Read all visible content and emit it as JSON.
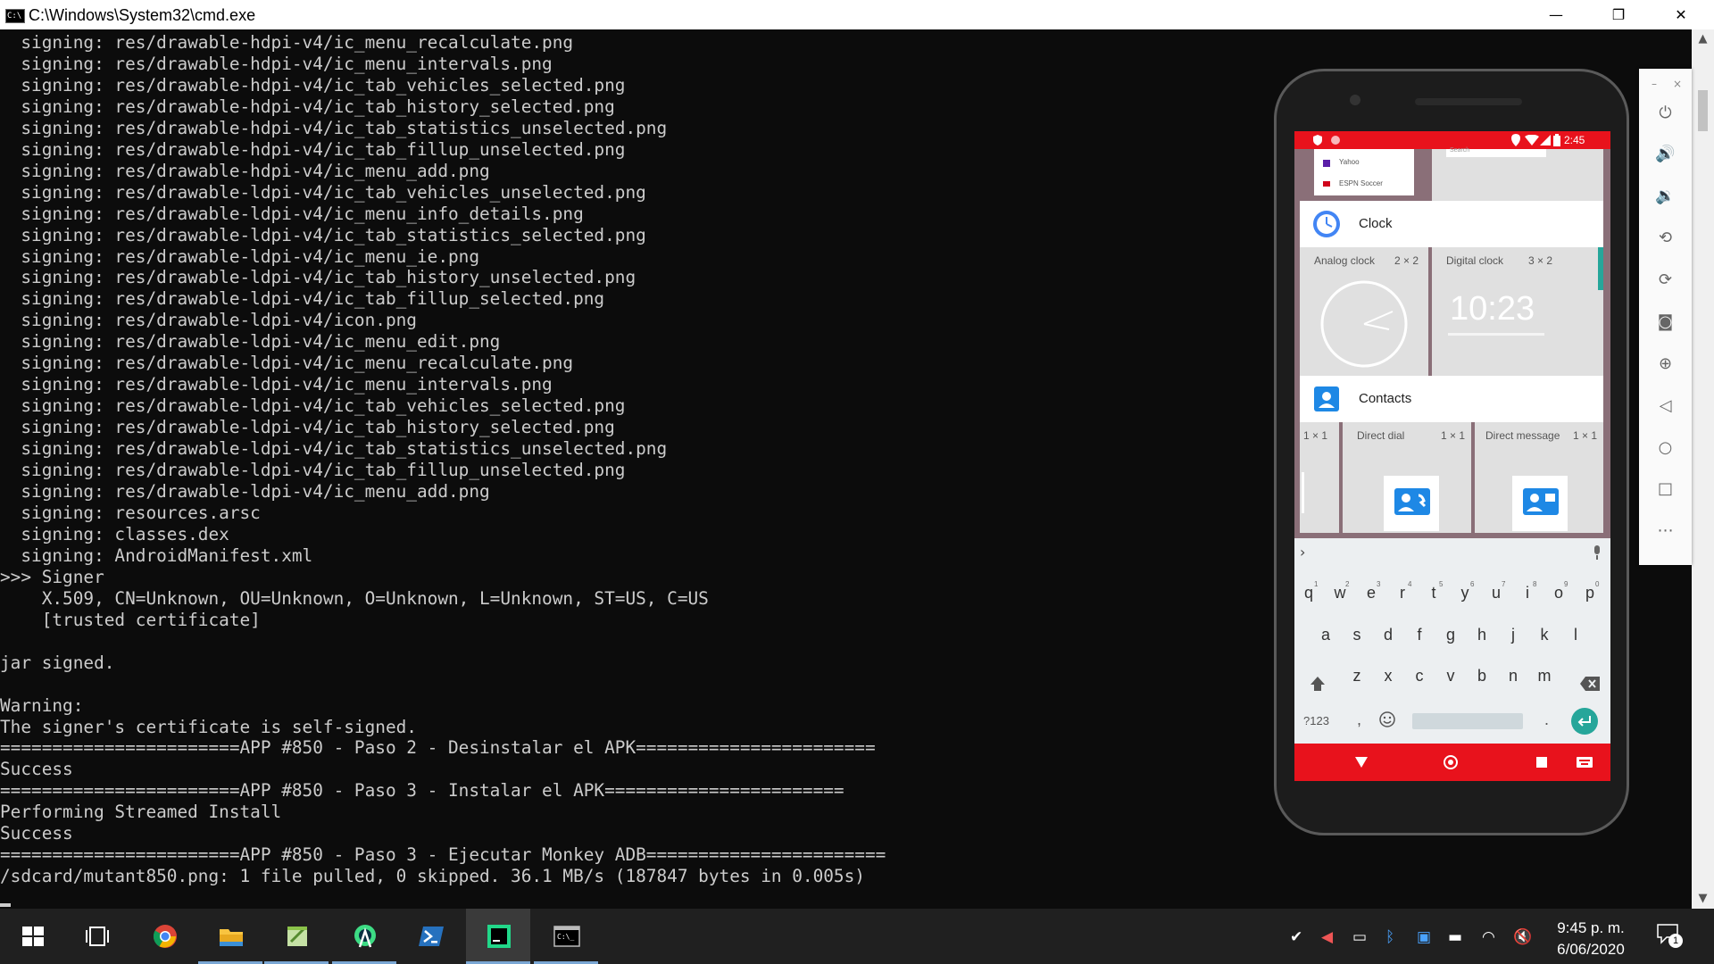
{
  "window": {
    "title": "C:\\Windows\\System32\\cmd.exe",
    "icon_text": "C:\\",
    "controls": {
      "minimize": "—",
      "maximize": "❐",
      "close": "✕"
    }
  },
  "console": {
    "lines": [
      "  signing: res/drawable-hdpi-v4/ic_menu_recalculate.png",
      "  signing: res/drawable-hdpi-v4/ic_menu_intervals.png",
      "  signing: res/drawable-hdpi-v4/ic_tab_vehicles_selected.png",
      "  signing: res/drawable-hdpi-v4/ic_tab_history_selected.png",
      "  signing: res/drawable-hdpi-v4/ic_tab_statistics_unselected.png",
      "  signing: res/drawable-hdpi-v4/ic_tab_fillup_unselected.png",
      "  signing: res/drawable-hdpi-v4/ic_menu_add.png",
      "  signing: res/drawable-ldpi-v4/ic_tab_vehicles_unselected.png",
      "  signing: res/drawable-ldpi-v4/ic_menu_info_details.png",
      "  signing: res/drawable-ldpi-v4/ic_tab_statistics_selected.png",
      "  signing: res/drawable-ldpi-v4/ic_menu_ie.png",
      "  signing: res/drawable-ldpi-v4/ic_tab_history_unselected.png",
      "  signing: res/drawable-ldpi-v4/ic_tab_fillup_selected.png",
      "  signing: res/drawable-ldpi-v4/icon.png",
      "  signing: res/drawable-ldpi-v4/ic_menu_edit.png",
      "  signing: res/drawable-ldpi-v4/ic_menu_recalculate.png",
      "  signing: res/drawable-ldpi-v4/ic_menu_intervals.png",
      "  signing: res/drawable-ldpi-v4/ic_tab_vehicles_selected.png",
      "  signing: res/drawable-ldpi-v4/ic_tab_history_selected.png",
      "  signing: res/drawable-ldpi-v4/ic_tab_statistics_unselected.png",
      "  signing: res/drawable-ldpi-v4/ic_tab_fillup_unselected.png",
      "  signing: res/drawable-ldpi-v4/ic_menu_add.png",
      "  signing: resources.arsc",
      "  signing: classes.dex",
      "  signing: AndroidManifest.xml",
      ">>> Signer",
      "    X.509, CN=Unknown, OU=Unknown, O=Unknown, L=Unknown, ST=US, C=US",
      "    [trusted certificate]",
      "",
      "jar signed.",
      "",
      "Warning:",
      "The signer's certificate is self-signed.",
      "=======================APP #850 - Paso 2 - Desinstalar el APK=======================",
      "Success",
      "=======================APP #850 - Paso 3 - Instalar el APK=======================",
      "Performing Streamed Install",
      "Success",
      "=======================APP #850 - Paso 3 - Ejecutar Monkey ADB=======================",
      "/sdcard/mutant850.png: 1 file pulled, 0 skipped. 36.1 MB/s (187847 bytes in 0.005s)"
    ]
  },
  "phone": {
    "status_time": "2:45",
    "widgets_top": {
      "item1": "Yahoo",
      "item2": "ESPN Soccer",
      "search_placeholder": "Search"
    },
    "clock_section": {
      "app": "Clock",
      "widgets": [
        {
          "name": "Analog clock",
          "size": "2 × 2"
        },
        {
          "name": "Digital clock",
          "size": "3 × 2",
          "time": "10:23"
        }
      ]
    },
    "contacts_section": {
      "app": "Contacts",
      "widgets": [
        {
          "name": "",
          "size": "1 × 1"
        },
        {
          "name": "Direct dial",
          "size": "1 × 1"
        },
        {
          "name": "Direct message",
          "size": "1 × 1"
        }
      ]
    },
    "keyboard": {
      "row1": [
        "q",
        "w",
        "e",
        "r",
        "t",
        "y",
        "u",
        "i",
        "o",
        "p"
      ],
      "row1_hints": [
        "1",
        "2",
        "3",
        "4",
        "5",
        "6",
        "7",
        "8",
        "9",
        "0"
      ],
      "row2": [
        "a",
        "s",
        "d",
        "f",
        "g",
        "h",
        "j",
        "k",
        "l"
      ],
      "row3": [
        "z",
        "x",
        "c",
        "v",
        "b",
        "n",
        "m"
      ],
      "symbols_key": "?123",
      "comma": ",",
      "period": "."
    }
  },
  "emulator_toolbar": {
    "icons": [
      "power-icon",
      "volume-up-icon",
      "volume-down-icon",
      "rotate-left-icon",
      "rotate-right-icon",
      "camera-icon",
      "zoom-icon",
      "back-icon",
      "home-icon",
      "overview-icon",
      "more-icon"
    ]
  },
  "taskbar": {
    "time": "9:45 p. m.",
    "date": "6/06/2020",
    "notification_count": "1",
    "apps": [
      "start",
      "task-view",
      "chrome",
      "file-explorer",
      "notepad-plus",
      "android-studio",
      "powershell",
      "pycharm",
      "cmd"
    ]
  },
  "colors": {
    "console_bg": "#0c0c0c",
    "console_fg": "#cccccc",
    "android_red": "#e8121c",
    "accent_teal": "#26a69a"
  }
}
